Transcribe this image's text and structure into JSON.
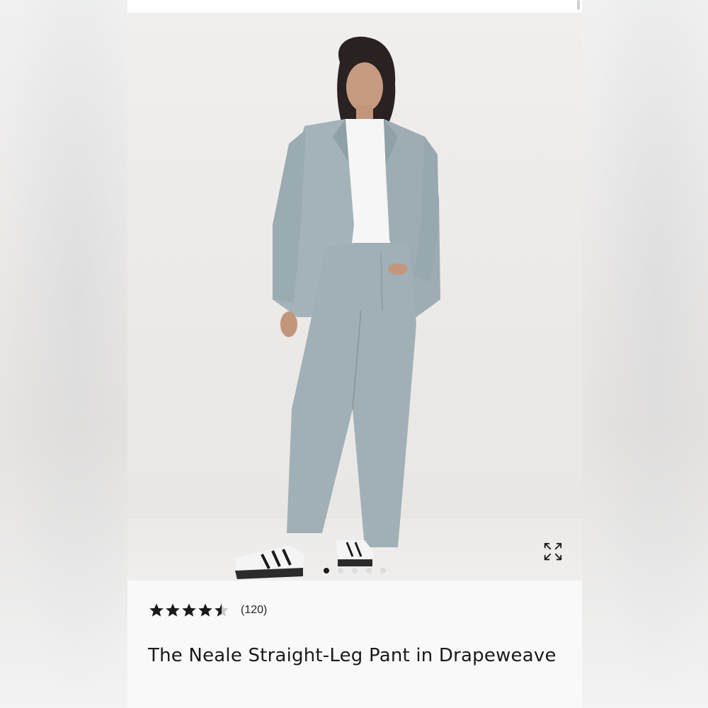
{
  "product": {
    "image_alt": "Model wearing light blue-gray blazer and wide straight-leg pants",
    "expand_icon": "expand-arrows-icon",
    "carousel": {
      "total": 5,
      "active_index": 0
    },
    "rating": {
      "value": 4.5,
      "max": 5,
      "count_text": "(120)"
    },
    "title": "The Neale Straight-Leg Pant in Drapeweave"
  },
  "colors": {
    "suit": "#9fb0b6",
    "shirt": "#f7f7f7",
    "star": "#1a1a1a",
    "star_empty": "#c8c8c8"
  }
}
